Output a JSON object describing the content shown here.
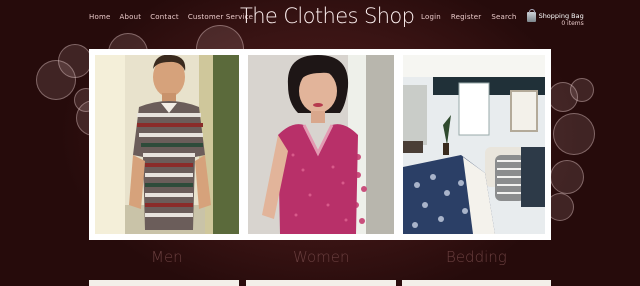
{
  "nav": {
    "left": [
      "Home",
      "About",
      "Contact",
      "Customer Service"
    ],
    "right": [
      "Login",
      "Register",
      "Search"
    ]
  },
  "logo": "The Clothes Shop",
  "cart": {
    "title": "Shopping Bag",
    "count": "0 items"
  },
  "categories": [
    {
      "label": "Men"
    },
    {
      "label": "Women"
    },
    {
      "label": "Bedding"
    }
  ],
  "colors": {
    "background": "#3a1414",
    "frame": "#ffffff",
    "caption": "#6a3f3f"
  }
}
